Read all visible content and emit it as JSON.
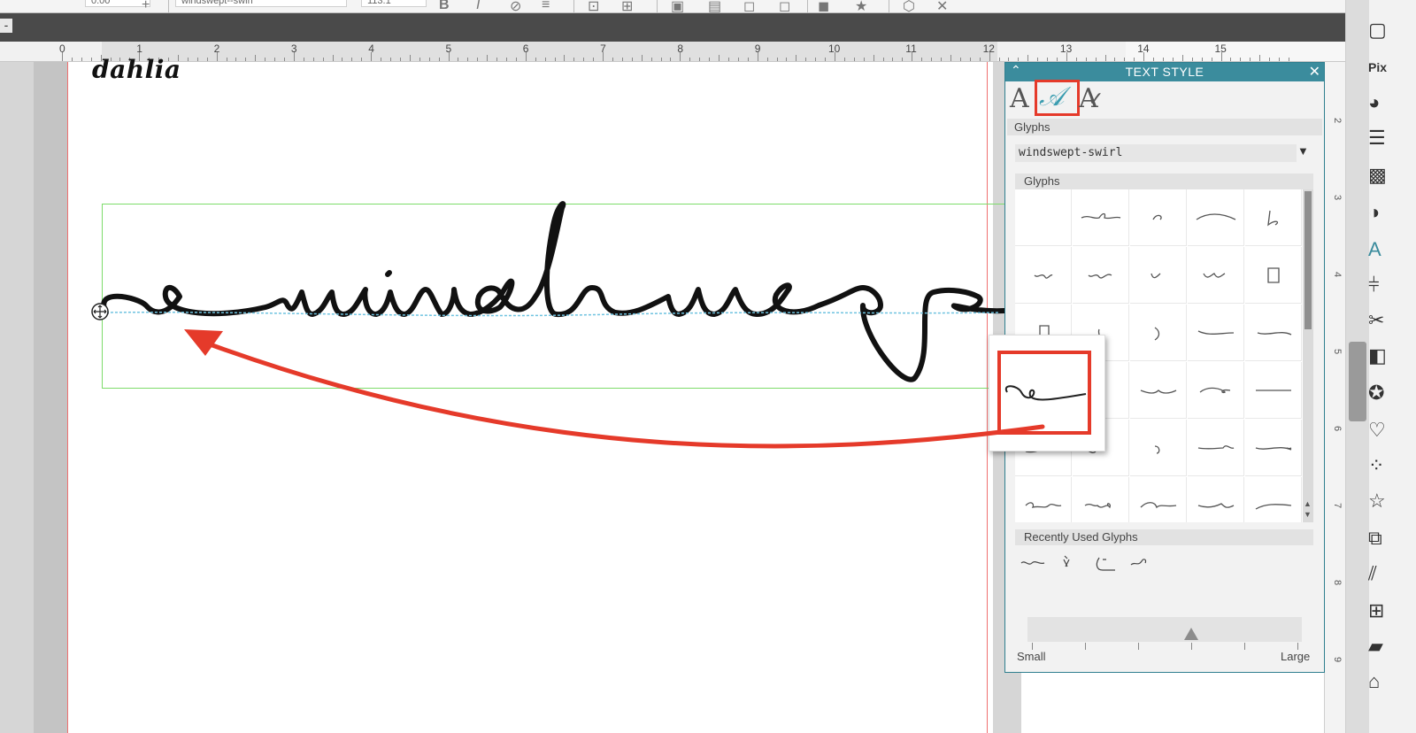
{
  "toolbar": {
    "line_width": "0.00",
    "font_name": "windswept--swirl",
    "font_size": "113.1"
  },
  "ruler": {
    "numbers": [
      "0",
      "1",
      "2",
      "3",
      "4",
      "5",
      "6",
      "7",
      "8",
      "9",
      "10",
      "11",
      "12",
      "13",
      "14",
      "15"
    ]
  },
  "vertical_ruler": {
    "numbers": [
      "2",
      "3",
      "4",
      "5",
      "6",
      "7",
      "8",
      "9"
    ]
  },
  "canvas": {
    "label_text": "dahlia",
    "main_text": "windswept"
  },
  "panel": {
    "title": "TEXT STYLE",
    "tab_text_glyph": "A",
    "tab_glyph_glyph": "𝒜",
    "tab_spell_glyph": "A",
    "section_glyphs": "Glyphs",
    "font_value": "windswept-swirl",
    "glyphs_subheader": "Glyphs",
    "recent_header": "Recently Used Glyphs",
    "size_small": "Small",
    "size_large": "Large",
    "size_level": 0.63
  },
  "icons": {
    "close": "close-icon",
    "collapse": "chevron-up-icon",
    "dropdown": "triangle-down-icon"
  },
  "colors": {
    "panel_title_bg": "#3b8c9d",
    "highlight_red": "#e53a2a",
    "selection_green": "#7ddc6a",
    "page_margin_red": "#f07070"
  }
}
